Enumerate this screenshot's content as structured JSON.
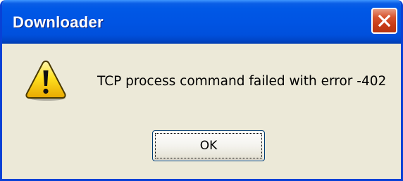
{
  "window": {
    "title": "Downloader",
    "title_bar_color": "#0054e3",
    "close_button_color": "#c63b16"
  },
  "dialog": {
    "icon": "warning-icon",
    "message": "TCP process command failed with error -402",
    "ok_label": "OK"
  }
}
